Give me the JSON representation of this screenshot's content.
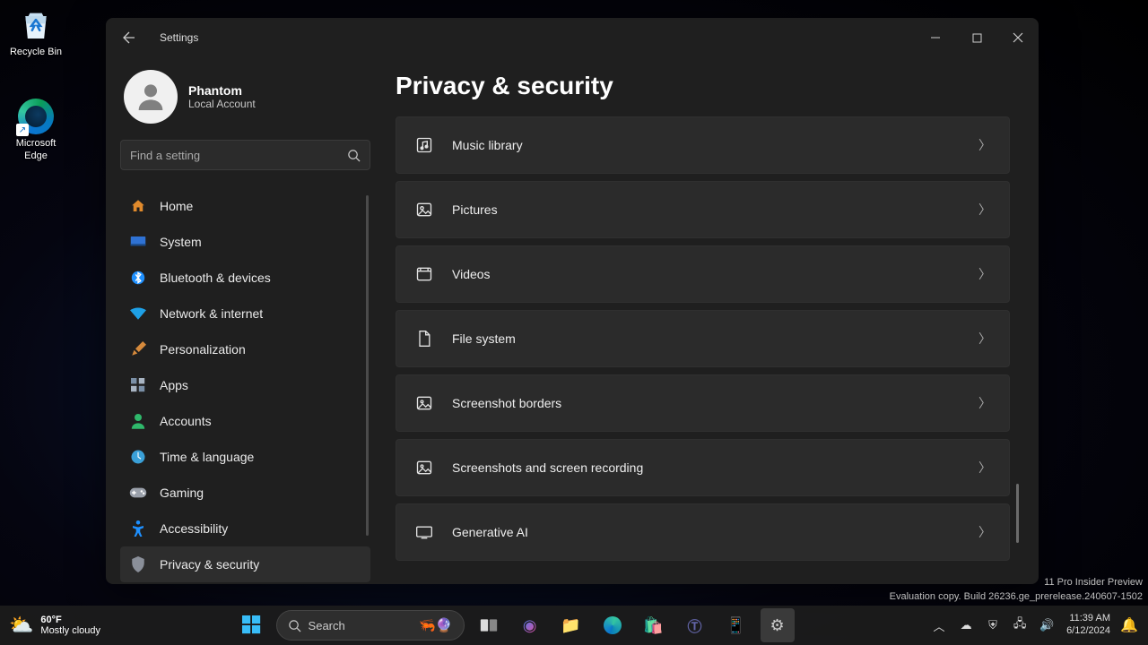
{
  "desktop": {
    "icons": [
      {
        "name": "recycle-bin",
        "label": "Recycle Bin"
      },
      {
        "name": "microsoft-edge",
        "label": "Microsoft Edge"
      }
    ]
  },
  "window": {
    "title": "Settings",
    "user": {
      "name": "Phantom",
      "subtitle": "Local Account"
    },
    "search": {
      "placeholder": "Find a setting"
    },
    "nav": [
      {
        "icon": "home-icon",
        "label": "Home",
        "color": "#e08a2c"
      },
      {
        "icon": "system-icon",
        "label": "System",
        "color": "#2f72d4"
      },
      {
        "icon": "bluetooth-icon",
        "label": "Bluetooth & devices",
        "color": "#1e90ff"
      },
      {
        "icon": "network-icon",
        "label": "Network & internet",
        "color": "#1ea0e6"
      },
      {
        "icon": "personalization-icon",
        "label": "Personalization",
        "color": "#d68a3c"
      },
      {
        "icon": "apps-icon",
        "label": "Apps",
        "color": "#7a8fa6"
      },
      {
        "icon": "accounts-icon",
        "label": "Accounts",
        "color": "#2fb86b"
      },
      {
        "icon": "time-language-icon",
        "label": "Time & language",
        "color": "#3aa0d8"
      },
      {
        "icon": "gaming-icon",
        "label": "Gaming",
        "color": "#9aa0aa"
      },
      {
        "icon": "accessibility-icon",
        "label": "Accessibility",
        "color": "#1e90ff"
      },
      {
        "icon": "privacy-security-icon",
        "label": "Privacy & security",
        "color": "#8a8f99",
        "active": true
      }
    ],
    "main": {
      "heading": "Privacy & security",
      "rows": [
        {
          "icon": "music-library-icon",
          "label": "Music library"
        },
        {
          "icon": "pictures-icon",
          "label": "Pictures"
        },
        {
          "icon": "videos-icon",
          "label": "Videos"
        },
        {
          "icon": "file-system-icon",
          "label": "File system"
        },
        {
          "icon": "screenshot-borders-icon",
          "label": "Screenshot borders"
        },
        {
          "icon": "screenshots-recording-icon",
          "label": "Screenshots and screen recording"
        },
        {
          "icon": "generative-ai-icon",
          "label": "Generative AI"
        }
      ]
    }
  },
  "watermark": {
    "line1": "11 Pro Insider Preview",
    "line2": "Evaluation copy. Build 26236.ge_prerelease.240607-1502"
  },
  "taskbar": {
    "weather": {
      "temp": "60°F",
      "desc": "Mostly cloudy"
    },
    "search_label": "Search",
    "clock": {
      "time": "11:39 AM",
      "date": "6/12/2024"
    }
  }
}
